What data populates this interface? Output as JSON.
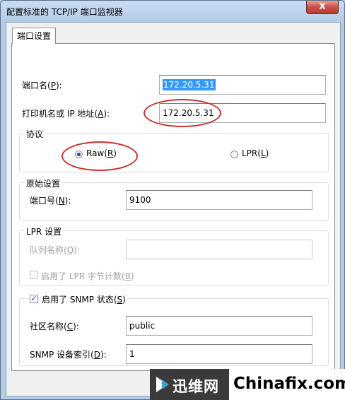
{
  "window": {
    "title": "配置标准的 TCP/IP 端口监视器",
    "close_label": "X"
  },
  "tab": {
    "label": "端口设置"
  },
  "port_name": {
    "label": "端口名(",
    "mnemonic": "P",
    "suffix": "):",
    "value": "172.20.5.31"
  },
  "printer_address": {
    "label": "打印机名或 IP 地址(",
    "mnemonic": "A",
    "suffix": "):",
    "value": "172.20.5.31"
  },
  "protocol": {
    "title": "协议",
    "raw": {
      "label": "Raw(",
      "mnemonic": "R",
      "suffix": ")",
      "selected": true
    },
    "lpr": {
      "label": "LPR(",
      "mnemonic": "L",
      "suffix": ")",
      "selected": false
    }
  },
  "raw_settings": {
    "title": "原始设置",
    "port_number": {
      "label": "端口号(",
      "mnemonic": "N",
      "suffix": "):",
      "value": "9100"
    }
  },
  "lpr_settings": {
    "title": "LPR 设置",
    "queue_name": {
      "label": "队列名称(",
      "mnemonic": "Q",
      "suffix": "):",
      "value": ""
    },
    "byte_counting": {
      "label": "启用了 LPR 字节计数(",
      "mnemonic": "B",
      "suffix": ")",
      "checked": false
    }
  },
  "snmp": {
    "enabled": {
      "label": "启用了 SNMP 状态(",
      "mnemonic": "S",
      "suffix": ")",
      "checked": true
    },
    "community": {
      "label": "社区名称(",
      "mnemonic": "C",
      "suffix": "):",
      "value": "public"
    },
    "device_index": {
      "label": "SNMP 设备索引(",
      "mnemonic": "D",
      "suffix": "):",
      "value": "1"
    }
  },
  "watermark": {
    "cn": "迅维网",
    "en": "Chinafix.com"
  },
  "colors": {
    "annotation": "#c8302f",
    "selection": "#3399ff",
    "accent": "#1d4f91"
  }
}
